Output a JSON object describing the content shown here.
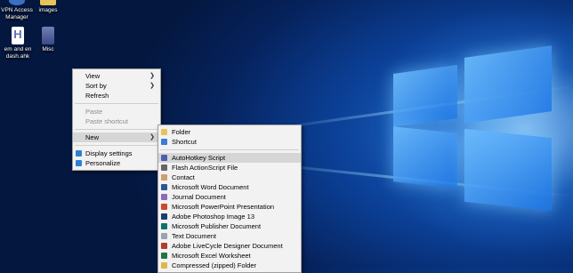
{
  "desktop": {
    "icons": [
      {
        "label": "VPN Access Manager",
        "icon": "vpn-icon",
        "color": "#3a6fc4"
      },
      {
        "label": "images",
        "icon": "folder-icon",
        "color": "#e8c35a"
      },
      {
        "label": "em and en dash.ahk",
        "icon": "autohotkey-icon",
        "color": "#5a6dbf"
      },
      {
        "label": "Misc",
        "icon": "archive-icon",
        "color": "#6f7fb8"
      }
    ]
  },
  "context_menu": {
    "items": [
      {
        "label": "View"
      },
      {
        "label": "Sort by"
      },
      {
        "label": "Refresh"
      },
      {
        "label": "Paste"
      },
      {
        "label": "Paste shortcut"
      },
      {
        "label": "New"
      },
      {
        "label": "Display settings",
        "icon": "display-icon",
        "color": "#2d7fd6"
      },
      {
        "label": "Personalize",
        "icon": "personalize-icon",
        "color": "#2d7fd6"
      }
    ]
  },
  "new_submenu": {
    "items": [
      {
        "label": "Folder",
        "icon": "folder-icon",
        "color": "#e8c35a"
      },
      {
        "label": "Shortcut",
        "icon": "shortcut-icon",
        "color": "#3a7bd5"
      },
      {
        "label": "AutoHotkey Script",
        "icon": "autohotkey-icon",
        "color": "#4b5fb0"
      },
      {
        "label": "Flash ActionScript File",
        "icon": "flash-icon",
        "color": "#666666"
      },
      {
        "label": "Contact",
        "icon": "contact-icon",
        "color": "#c9a26b"
      },
      {
        "label": "Microsoft Word Document",
        "icon": "word-icon",
        "color": "#2b579a"
      },
      {
        "label": "Journal Document",
        "icon": "journal-icon",
        "color": "#8a6ab8"
      },
      {
        "label": "Microsoft PowerPoint Presentation",
        "icon": "powerpoint-icon",
        "color": "#d24726"
      },
      {
        "label": "Adobe Photoshop Image 13",
        "icon": "photoshop-icon",
        "color": "#1c3d6e"
      },
      {
        "label": "Microsoft Publisher Document",
        "icon": "publisher-icon",
        "color": "#077568"
      },
      {
        "label": "Text Document",
        "icon": "text-document-icon",
        "color": "#9aa4b0"
      },
      {
        "label": "Adobe LiveCycle Designer Document",
        "icon": "livecycle-icon",
        "color": "#b43c2d"
      },
      {
        "label": "Microsoft Excel Worksheet",
        "icon": "excel-icon",
        "color": "#217346"
      },
      {
        "label": "Compressed (zipped) Folder",
        "icon": "zip-folder-icon",
        "color": "#e0b84a"
      }
    ]
  }
}
